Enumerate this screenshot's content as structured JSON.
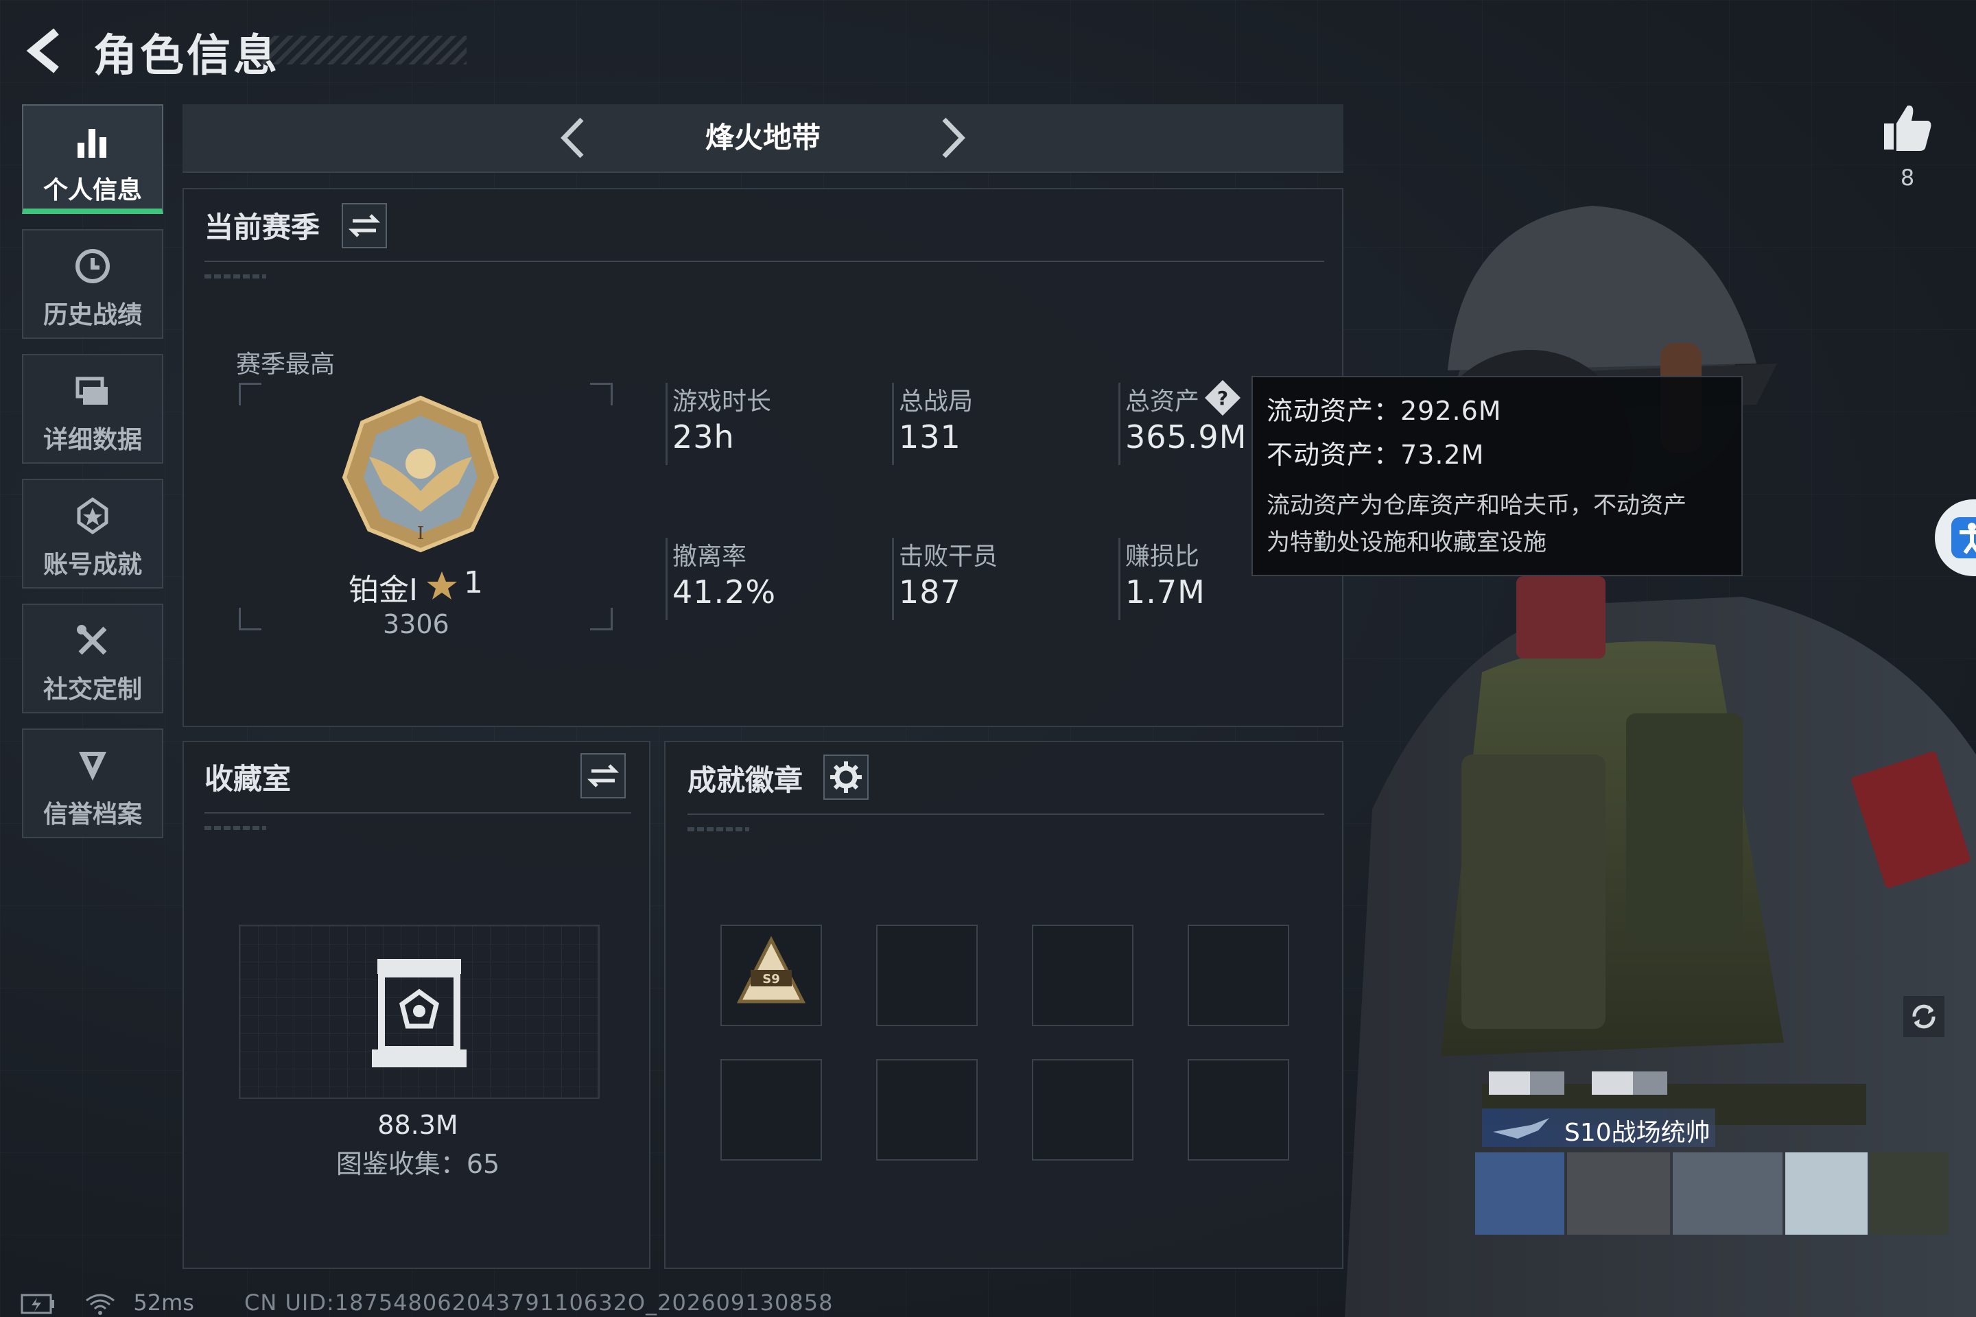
{
  "header": {
    "title": "角色信息"
  },
  "sidebar": {
    "items": [
      {
        "label": "个人信息",
        "icon": "bar-chart-icon",
        "active": true
      },
      {
        "label": "历史战绩",
        "icon": "history-clock-icon",
        "active": false
      },
      {
        "label": "详细数据",
        "icon": "cards-stack-icon",
        "active": false
      },
      {
        "label": "账号成就",
        "icon": "achievement-star-icon",
        "active": false
      },
      {
        "label": "社交定制",
        "icon": "tools-cross-icon",
        "active": false
      },
      {
        "label": "信誉档案",
        "icon": "shield-badge-icon",
        "active": false
      }
    ]
  },
  "mode": {
    "title": "烽火地带"
  },
  "season": {
    "title": "当前赛季",
    "best_label": "赛季最高",
    "rank_name": "铂金Ⅰ",
    "rank_stars": "1",
    "rank_score": "3306",
    "stats": [
      {
        "label": "游戏时长",
        "value": "23h"
      },
      {
        "label": "总战局",
        "value": "131"
      },
      {
        "label": "总资产",
        "value": "365.9M"
      },
      {
        "label": "撤离率",
        "value": "41.2%"
      },
      {
        "label": "击败干员",
        "value": "187"
      },
      {
        "label": "赚损比",
        "value": "1.7M"
      }
    ]
  },
  "tooltip": {
    "liquid": "流动资产：292.6M",
    "fixed": "不动资产：73.2M",
    "desc_line1": "流动资产为仓库资产和哈夫币，不动资产",
    "desc_line2": "为特勤处设施和收藏室设施"
  },
  "collection": {
    "title": "收藏室",
    "value": "88.3M",
    "count_text": "图鉴收集：65"
  },
  "badges": {
    "title": "成就徽章",
    "first_badge_text": "S9"
  },
  "likes": {
    "count": "8"
  },
  "player_title": {
    "text": "S10战场统帅"
  },
  "status": {
    "ping": "52ms",
    "uid": "CN UID:18754806204379110632O_202609130858"
  },
  "colors": {
    "accent": "#3fc47d",
    "background": "#1b2027",
    "panel": "#1d2229"
  }
}
